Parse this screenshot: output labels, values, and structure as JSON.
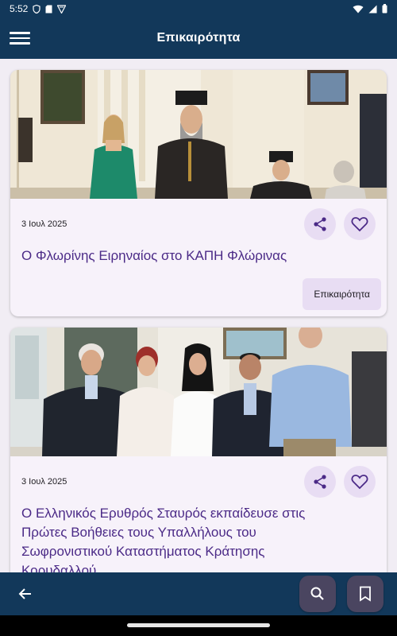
{
  "status_bar": {
    "time": "5:52"
  },
  "app_bar": {
    "title": "Επικαιρότητα"
  },
  "articles": [
    {
      "date": "3 Ιουλ 2025",
      "title": "Ο Φλωρίνης Ειρηναίος στο ΚΑΠΗ Φλώρινας",
      "category": "Επικαιρότητα"
    },
    {
      "date": "3 Ιουλ 2025",
      "title": "Ο Ελληνικός Ερυθρός Σταυρός εκπαίδευσε στις Πρώτες Βοήθειες τους Υπαλλήλους του Σωφρονιστικού Καταστήματος Κράτησης Κορυδαλλού"
    }
  ],
  "icons": {
    "menu": "menu-icon",
    "share": "share-icon",
    "favorite": "heart-icon",
    "back": "arrow-back-icon",
    "search": "search-icon",
    "bookmark": "bookmark-icon"
  },
  "colors": {
    "primary": "#12385a",
    "accent": "#4b2a87",
    "chip": "#e8ddf3",
    "fab": "#4a4560"
  }
}
